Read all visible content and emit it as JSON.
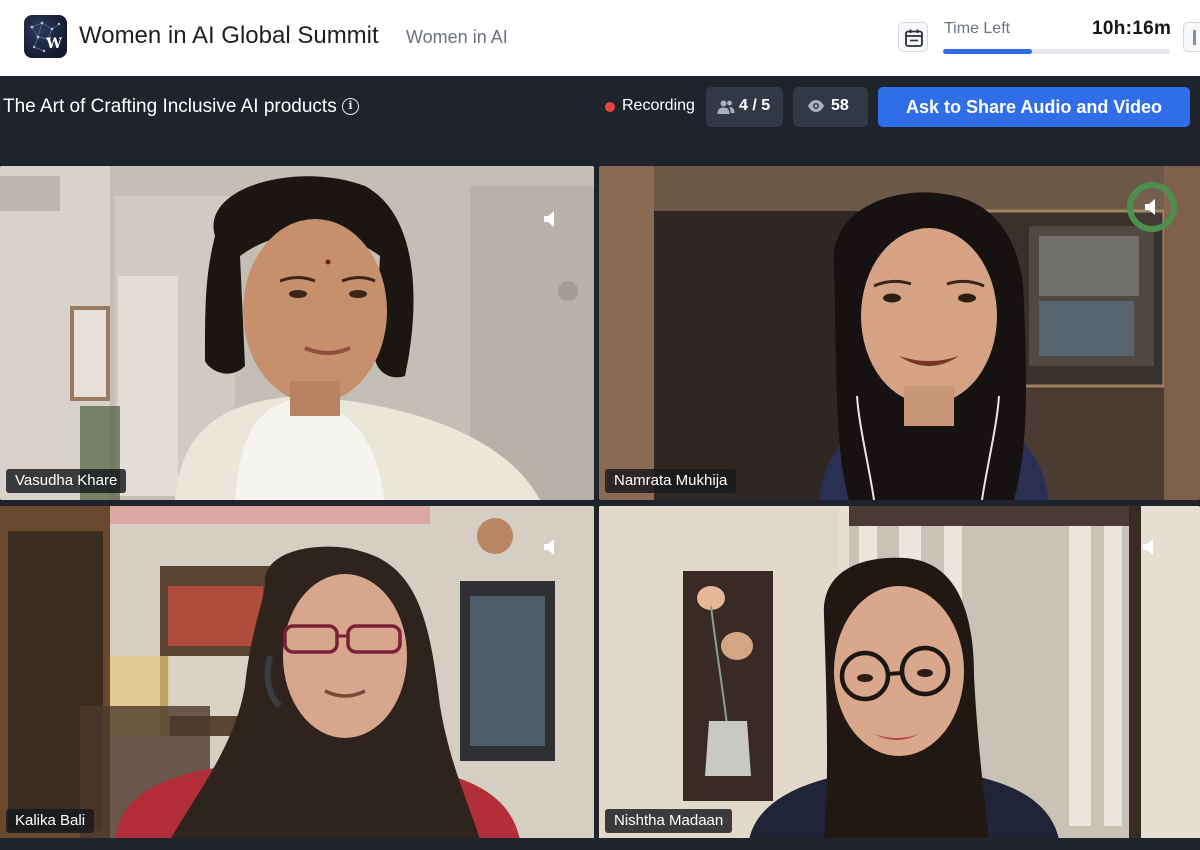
{
  "header": {
    "event_title": "Women in AI Global Summit",
    "org_name": "Women in AI",
    "logo_letter": "W",
    "time_left_label": "Time Left",
    "time_left_value": "10h:16m",
    "time_progress_fraction": 0.39
  },
  "session": {
    "title": "The Art of Crafting Inclusive AI products",
    "recording_label": "Recording",
    "participants": "4 / 5",
    "viewers": "58",
    "share_button_label": "Ask to Share Audio and Video"
  },
  "participants": [
    {
      "name": "Vasudha Khare",
      "speaking": false
    },
    {
      "name": "Namrata Mukhija",
      "speaking": true
    },
    {
      "name": "Kalika Bali",
      "speaking": false
    },
    {
      "name": "Nishtha Madaan",
      "speaking": false
    }
  ],
  "colors": {
    "accent_blue": "#2f6ee8",
    "recording_red": "#e8453c",
    "speaking_ring": "#4f8f4e",
    "stage_background": "#1f232b"
  },
  "icons": [
    "calendar-icon",
    "info-icon",
    "participants-icon",
    "eye-icon",
    "speaker-icon"
  ]
}
